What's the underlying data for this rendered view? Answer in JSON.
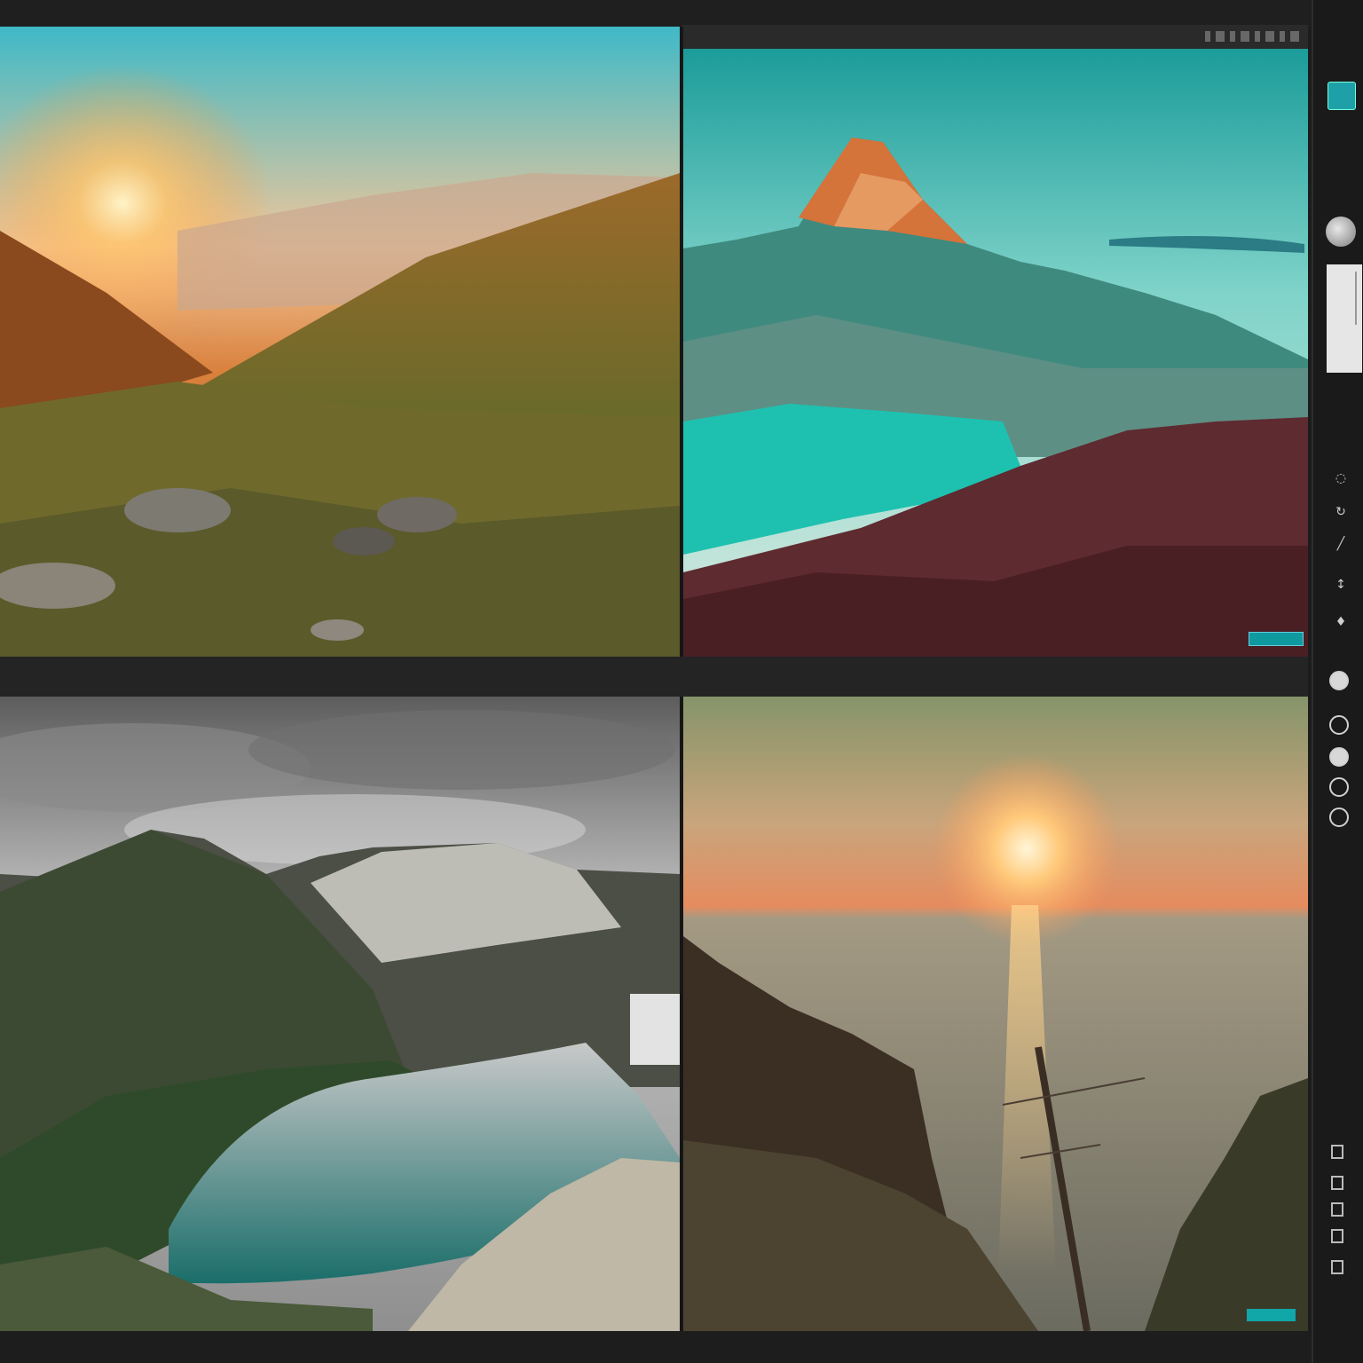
{
  "app": {
    "accent_color": "#1fa0a8",
    "background_color": "#1c1c1c"
  },
  "gallery": {
    "tiles": [
      {
        "name": "sunset-valley-photo"
      },
      {
        "name": "teal-peak-lake-photo"
      },
      {
        "name": "grey-sky-lake-photo"
      },
      {
        "name": "ocean-sunset-cliff-photo"
      }
    ]
  },
  "tools": {
    "items": [
      {
        "icon": "crop-icon"
      },
      {
        "icon": "rotate-icon"
      },
      {
        "icon": "brush-icon"
      },
      {
        "icon": "adjust-icon"
      },
      {
        "icon": "pin-icon"
      }
    ]
  }
}
